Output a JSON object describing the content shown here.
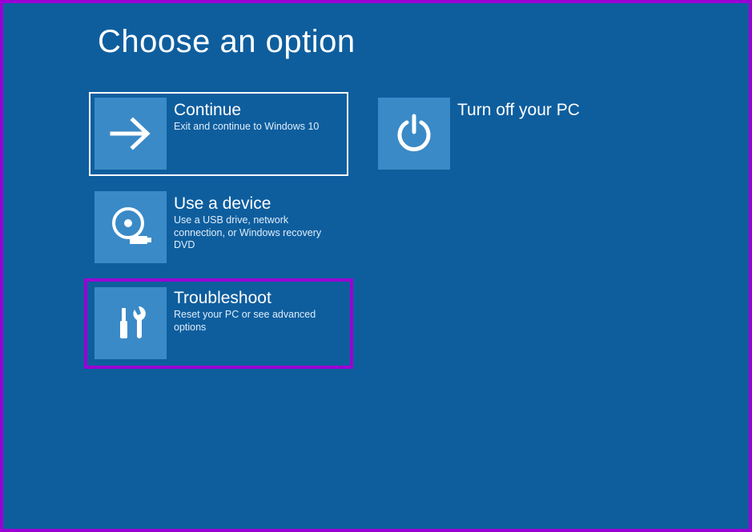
{
  "title": "Choose an option",
  "options": {
    "continue": {
      "title": "Continue",
      "sub": "Exit and continue to Windows 10",
      "icon": "arrow-right-icon"
    },
    "turn_off": {
      "title": "Turn off your PC",
      "sub": "",
      "icon": "power-icon"
    },
    "use_device": {
      "title": "Use a device",
      "sub": "Use a USB drive, network connection, or Windows recovery DVD",
      "icon": "disc-icon"
    },
    "troubleshoot": {
      "title": "Troubleshoot",
      "sub": "Reset your PC or see advanced options",
      "icon": "tools-icon"
    }
  },
  "colors": {
    "bg": "#0e5e9e",
    "tileIcon": "#3a8ac7",
    "selectedBorder": "#ffffff",
    "annotation": "#9a00d4"
  }
}
